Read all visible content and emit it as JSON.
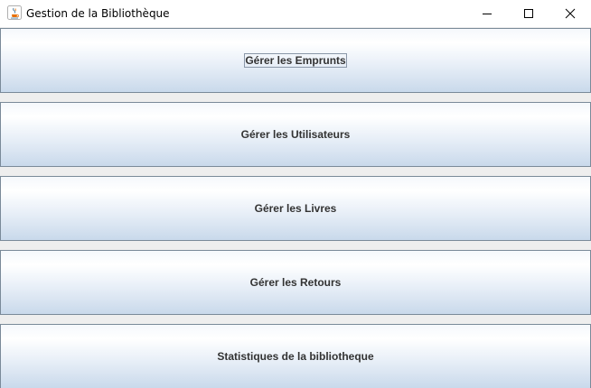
{
  "window": {
    "title": "Gestion de la Bibliothèque",
    "icon": "java-cup-icon"
  },
  "controls": {
    "minimize_icon": "minimize-icon",
    "maximize_icon": "maximize-icon",
    "close_icon": "close-icon"
  },
  "menu": {
    "buttons": [
      {
        "label": "Gérer les Emprunts",
        "focused": true
      },
      {
        "label": "Gérer les Utilisateurs",
        "focused": false
      },
      {
        "label": "Gérer les Livres",
        "focused": false
      },
      {
        "label": "Gérer les Retours",
        "focused": false
      },
      {
        "label": "Statistiques de la bibliotheque",
        "focused": false
      }
    ]
  },
  "colors": {
    "button_border": "#7a8a99",
    "button_gradient_top": "#ffffff",
    "button_gradient_bottom": "#c9d9eb",
    "button_text": "#333333",
    "background": "#eeeeee"
  }
}
